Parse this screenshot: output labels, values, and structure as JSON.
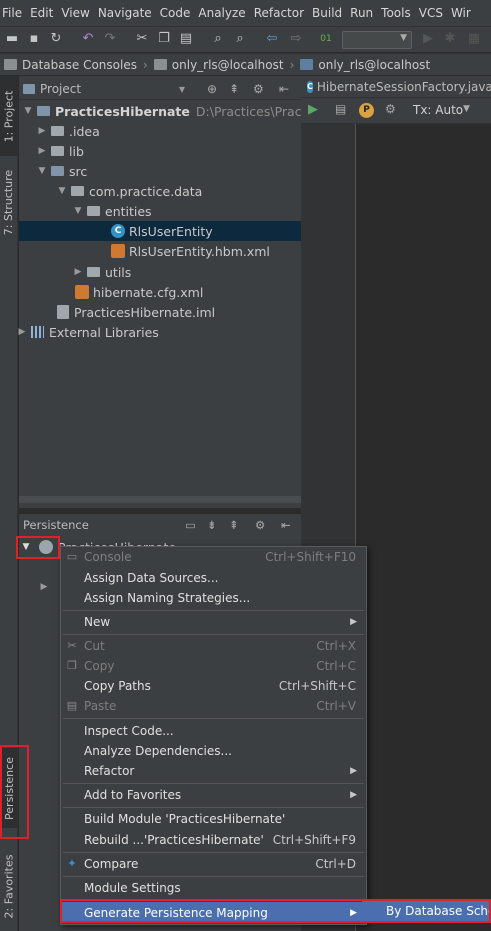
{
  "menubar": [
    "File",
    "Edit",
    "View",
    "Navigate",
    "Code",
    "Analyze",
    "Refactor",
    "Build",
    "Run",
    "Tools",
    "VCS",
    "Wir"
  ],
  "navbar": {
    "crumbs": [
      "Database Consoles",
      "only_rls@localhost",
      "only_rls@localhost"
    ]
  },
  "left_tabs": {
    "project": "1: Project",
    "structure": "7: Structure",
    "persistence": "Persistence",
    "favorites": "2: Favorites"
  },
  "project_panel": {
    "title": "Project",
    "tree": [
      {
        "label": "PracticesHibernate",
        "extra": "D:\\Practices\\PracticesHi"
      },
      {
        "label": ".idea"
      },
      {
        "label": "lib"
      },
      {
        "label": "src"
      },
      {
        "label": "com.practice.data"
      },
      {
        "label": "entities"
      },
      {
        "label": "RlsUserEntity"
      },
      {
        "label": "RlsUserEntity.hbm.xml"
      },
      {
        "label": "utils"
      },
      {
        "label": "hibernate.cfg.xml"
      },
      {
        "label": "PracticesHibernate.iml"
      },
      {
        "label": "External Libraries"
      }
    ]
  },
  "editor": {
    "tab": "HibernateSessionFactory.java",
    "tx": "Tx: Auto"
  },
  "persistence_panel": {
    "title": "Persistence",
    "item": "PracticesHibernate"
  },
  "context_menu": {
    "items": [
      {
        "label": "Console",
        "shortcut": "Ctrl+Shift+F10"
      },
      {
        "label": "Assign Data Sources...",
        "shortcut": ""
      },
      {
        "label": "Assign Naming Strategies...",
        "shortcut": ""
      },
      {
        "label": "New",
        "shortcut": ""
      },
      {
        "label": "Cut",
        "shortcut": "Ctrl+X"
      },
      {
        "label": "Copy",
        "shortcut": "Ctrl+C"
      },
      {
        "label": "Copy Paths",
        "shortcut": "Ctrl+Shift+C"
      },
      {
        "label": "Paste",
        "shortcut": "Ctrl+V"
      },
      {
        "label": "Inspect Code...",
        "shortcut": ""
      },
      {
        "label": "Analyze Dependencies...",
        "shortcut": ""
      },
      {
        "label": "Refactor",
        "shortcut": ""
      },
      {
        "label": "Add to Favorites",
        "shortcut": ""
      },
      {
        "label": "Build Module 'PracticesHibernate'",
        "shortcut": ""
      },
      {
        "label": "Rebuild ...'PracticesHibernate'",
        "shortcut": "Ctrl+Shift+F9"
      },
      {
        "label": "Compare",
        "shortcut": "Ctrl+D"
      },
      {
        "label": "Module Settings",
        "shortcut": ""
      },
      {
        "label": "Generate Persistence Mapping",
        "shortcut": ""
      }
    ],
    "submenu": "By Database Schema"
  },
  "colors": {
    "highlight": "#4b6eaf",
    "annotation": "#e0202a",
    "selection": "#0d293e"
  }
}
